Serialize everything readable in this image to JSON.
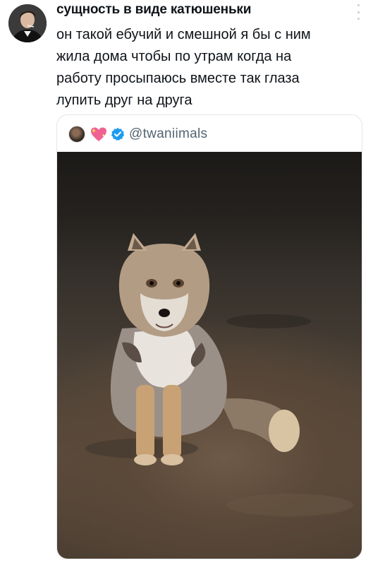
{
  "tweet": {
    "author_name": "сущность в виде катюшеньки",
    "text": "он такой ебучий и смешной я бы с ним\nжила дома чтобы по утрам когда на\nработу просыпаюсь вместе так глаза\nлупить друг на друга",
    "avatar_icon": "user-avatar-icon",
    "more_icon": "more-options-icon"
  },
  "quoted": {
    "handle": "@twaniimals",
    "avatar_icon": "quoted-avatar-icon",
    "emoji_icon": "sparkling-heart-icon",
    "verified_icon": "verified-badge-icon",
    "verified_color": "#1d9bf0",
    "photo_subject": "fox-photo"
  },
  "colors": {
    "text": "#0f1419",
    "secondary_text": "#536471",
    "border": "#e3e6e8"
  }
}
